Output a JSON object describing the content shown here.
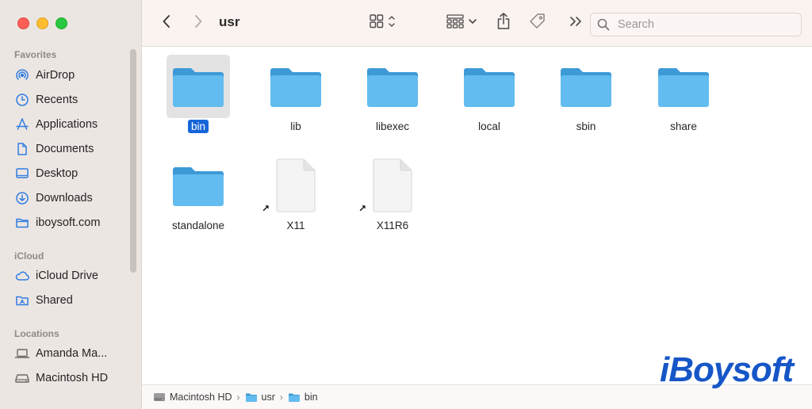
{
  "window": {
    "title": "usr"
  },
  "sidebar": {
    "sections": [
      {
        "label": "Favorites",
        "items": [
          {
            "label": "AirDrop",
            "icon": "airdrop-icon"
          },
          {
            "label": "Recents",
            "icon": "clock-icon"
          },
          {
            "label": "Applications",
            "icon": "applications-icon"
          },
          {
            "label": "Documents",
            "icon": "document-icon"
          },
          {
            "label": "Desktop",
            "icon": "desktop-icon"
          },
          {
            "label": "Downloads",
            "icon": "download-icon"
          },
          {
            "label": "iboysoft.com",
            "icon": "folder-icon"
          }
        ]
      },
      {
        "label": "iCloud",
        "items": [
          {
            "label": "iCloud Drive",
            "icon": "cloud-icon"
          },
          {
            "label": "Shared",
            "icon": "shared-folder-icon"
          }
        ]
      },
      {
        "label": "Locations",
        "items": [
          {
            "label": "Amanda Ma...",
            "icon": "laptop-icon"
          },
          {
            "label": "Macintosh HD",
            "icon": "drive-icon"
          }
        ]
      }
    ]
  },
  "toolbar": {
    "search_placeholder": "Search"
  },
  "files": [
    {
      "name": "bin",
      "type": "folder",
      "selected": true
    },
    {
      "name": "lib",
      "type": "folder"
    },
    {
      "name": "libexec",
      "type": "folder"
    },
    {
      "name": "local",
      "type": "folder"
    },
    {
      "name": "sbin",
      "type": "folder"
    },
    {
      "name": "share",
      "type": "folder"
    },
    {
      "name": "standalone",
      "type": "folder"
    },
    {
      "name": "X11",
      "type": "alias"
    },
    {
      "name": "X11R6",
      "type": "alias"
    }
  ],
  "pathbar": {
    "crumbs": [
      {
        "label": "Macintosh HD",
        "icon": "drive-icon"
      },
      {
        "label": "usr",
        "icon": "folder-icon"
      },
      {
        "label": "bin",
        "icon": "folder-icon"
      }
    ]
  },
  "watermark": {
    "text": "iBoysoft"
  },
  "colors": {
    "accent": "#1665d8",
    "folder": "#5fb8ee",
    "sidebar_icon": "#2f7de1"
  }
}
